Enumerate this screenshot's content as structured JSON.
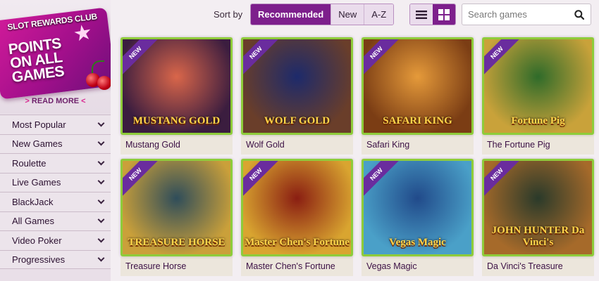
{
  "sidebar": {
    "promo": {
      "brand": "SLOT REWARDS CLUB",
      "title_line1": "POINTS",
      "title_line2": "ON ALL GAMES",
      "read_more": "READ MORE"
    },
    "items": [
      {
        "label": "Most Popular"
      },
      {
        "label": "New Games"
      },
      {
        "label": "Roulette"
      },
      {
        "label": "Live Games"
      },
      {
        "label": "BlackJack"
      },
      {
        "label": "All Games"
      },
      {
        "label": "Video Poker"
      },
      {
        "label": "Progressives"
      }
    ]
  },
  "toolbar": {
    "sort_label": "Sort by",
    "sort_options": [
      "Recommended",
      "New",
      "A-Z"
    ],
    "sort_selected": "Recommended",
    "view_modes": [
      "list-icon",
      "grid-icon"
    ],
    "view_selected": "grid-icon",
    "search_placeholder": "Search games"
  },
  "games": [
    {
      "name": "Mustang Gold",
      "badge": "NEW",
      "logo": "MUSTANG GOLD",
      "colors": [
        "#d9664a",
        "#3b1d3f"
      ]
    },
    {
      "name": "Wolf Gold",
      "badge": "NEW",
      "logo": "WOLF GOLD",
      "colors": [
        "#1d2a6b",
        "#6a3e2a"
      ]
    },
    {
      "name": "Safari King",
      "badge": "NEW",
      "logo": "SAFARI KING",
      "colors": [
        "#e59a3a",
        "#7b3d14"
      ]
    },
    {
      "name": "The Fortune Pig",
      "badge": "NEW",
      "logo": "Fortune Pig",
      "colors": [
        "#2f6b2a",
        "#c9a23a"
      ]
    },
    {
      "name": "Treasure Horse",
      "badge": "NEW",
      "logo": "TREASURE HORSE",
      "colors": [
        "#2f4d5a",
        "#caa03a"
      ]
    },
    {
      "name": "Master Chen's Fortune",
      "badge": "NEW",
      "logo": "Master Chen's Fortune",
      "colors": [
        "#8a1e12",
        "#d9a530"
      ]
    },
    {
      "name": "Vegas Magic",
      "badge": "NEW",
      "logo": "Vegas Magic",
      "colors": [
        "#214a8a",
        "#4aa0c8"
      ]
    },
    {
      "name": "Da Vinci's Treasure",
      "badge": "NEW",
      "logo": "JOHN HUNTER Da Vinci's",
      "colors": [
        "#2a3a2a",
        "#a66a2a"
      ]
    }
  ],
  "colors": {
    "accent": "#7d1f8c",
    "thumb_border": "#8ecc3a",
    "badge": "#6a2c9e"
  }
}
